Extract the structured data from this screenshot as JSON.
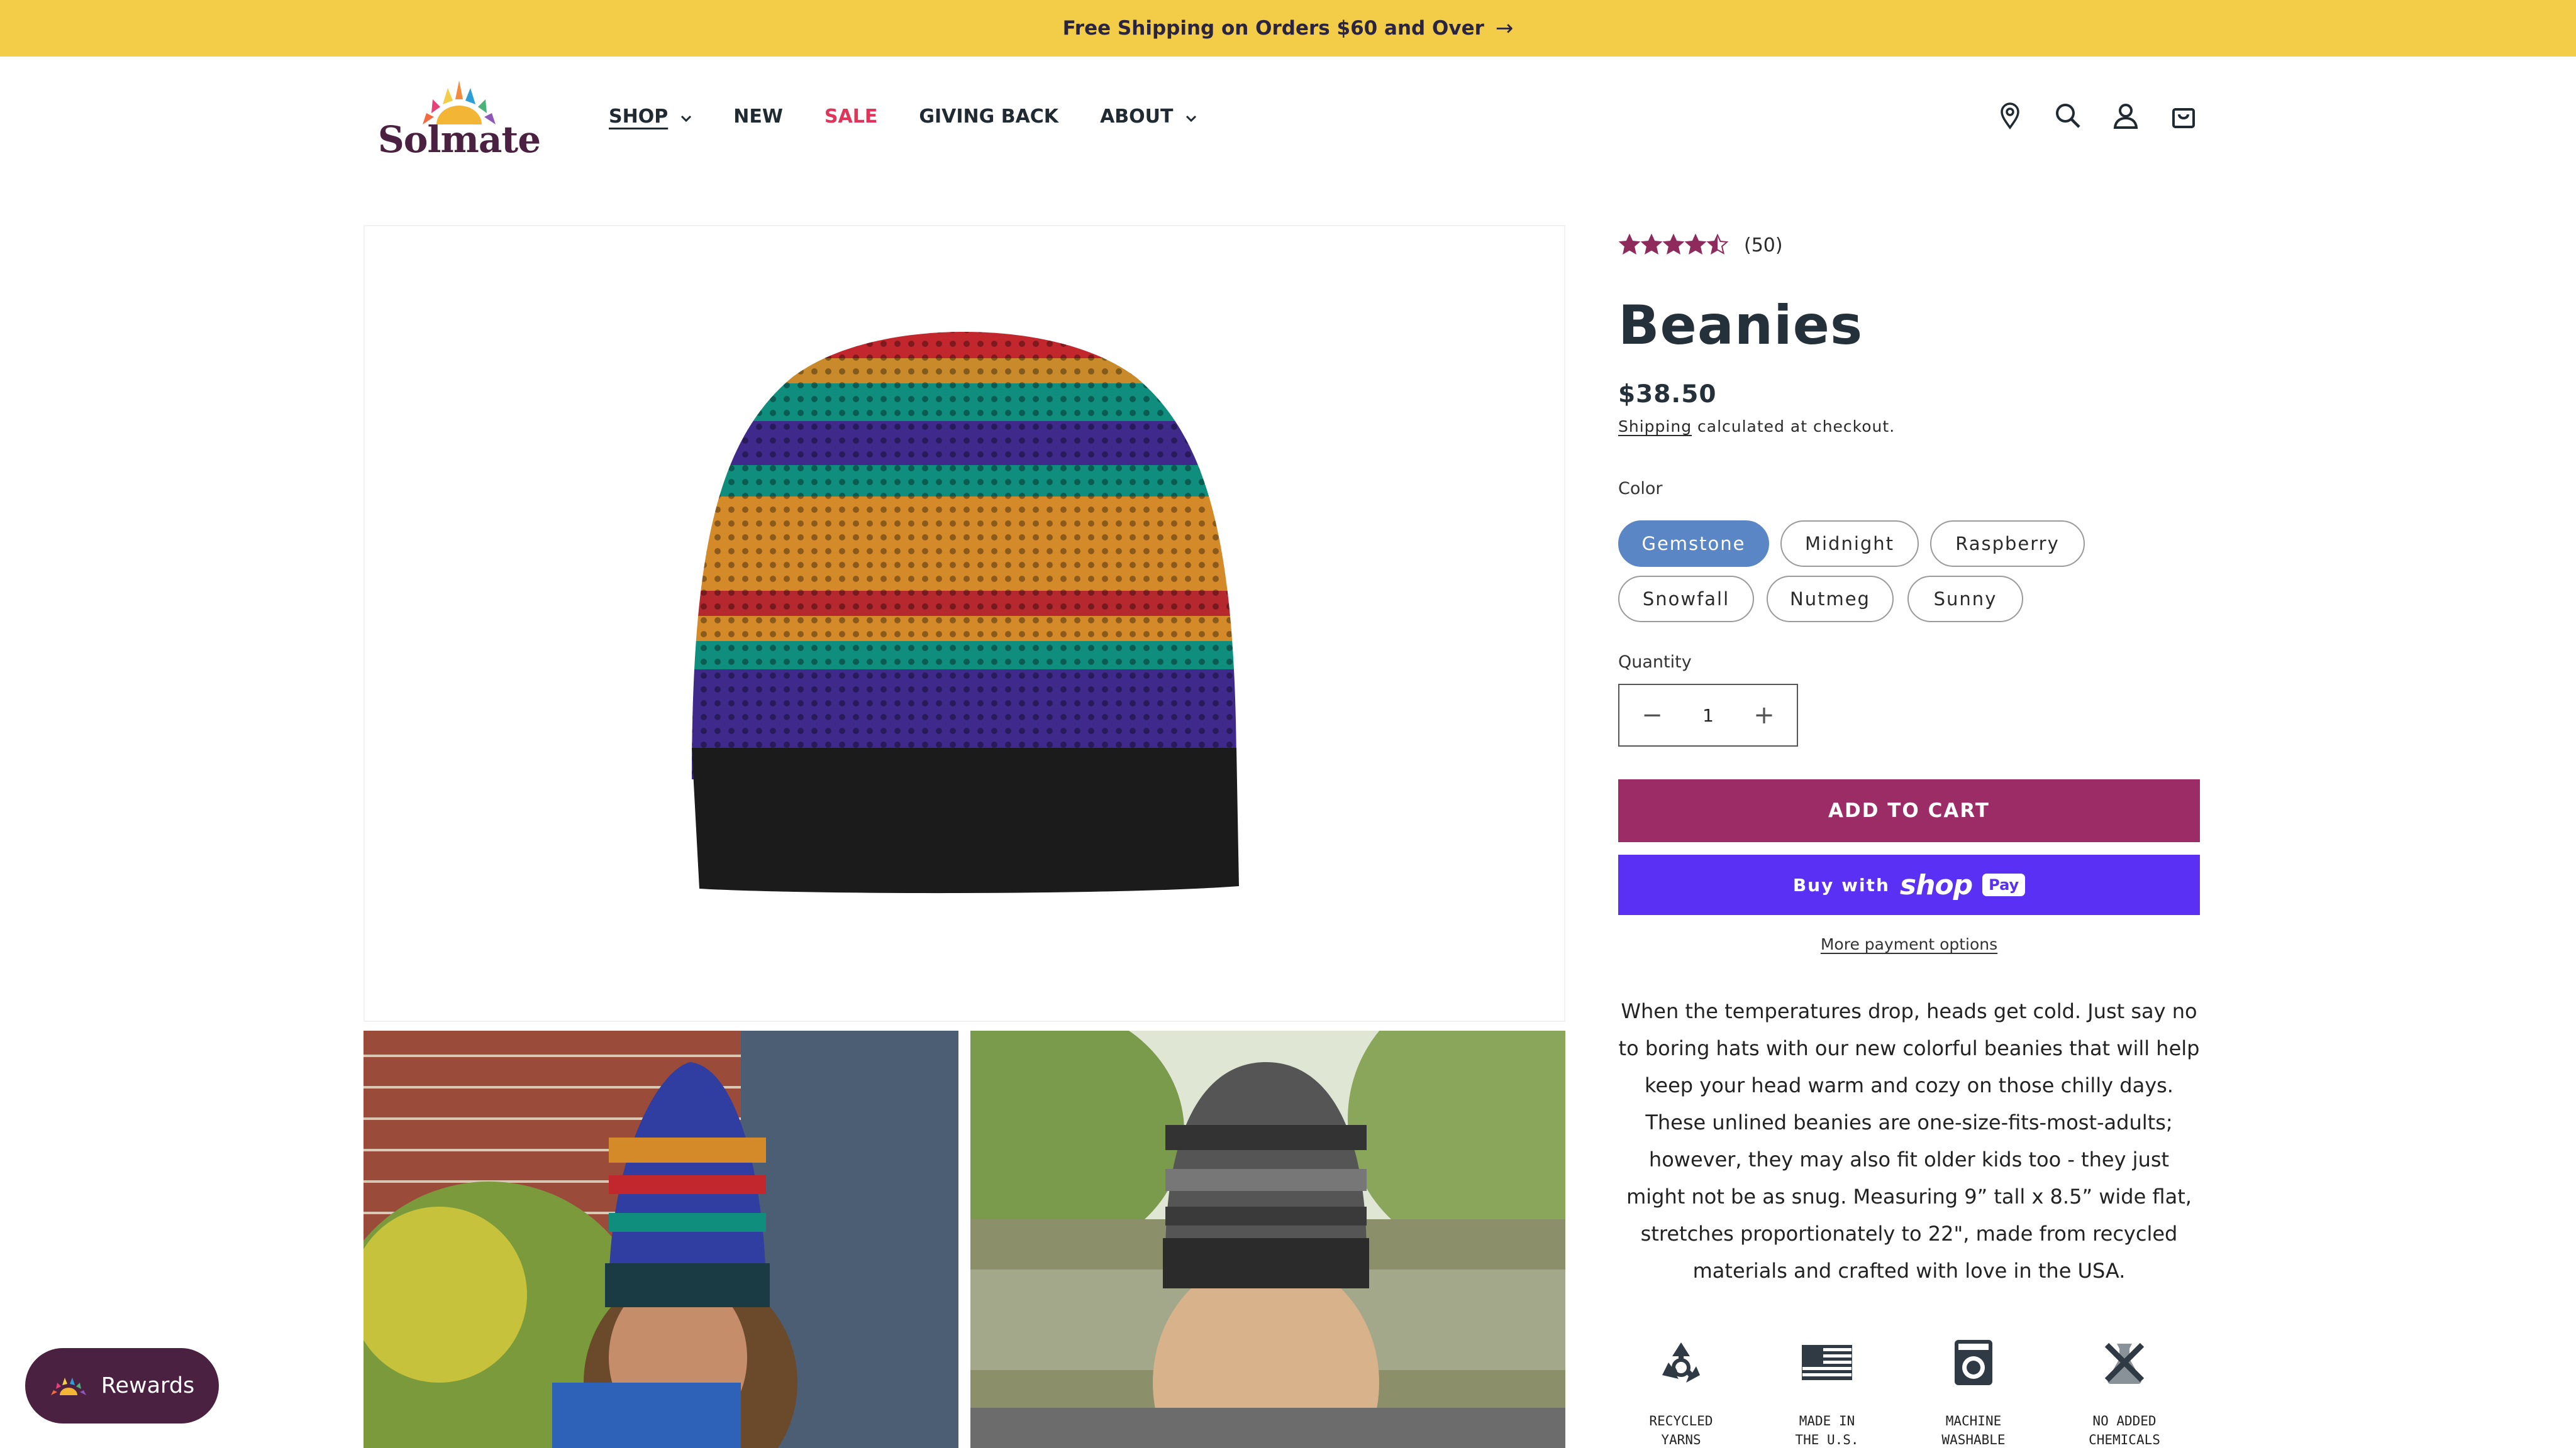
{
  "announcement": {
    "text": "Free Shipping on Orders $60 and Over",
    "arrow_icon": "arrow-right-icon"
  },
  "brand": {
    "name": "Solmate"
  },
  "nav": {
    "shop": "SHOP",
    "new": "NEW",
    "sale": "SALE",
    "giving_back": "GIVING BACK",
    "about": "ABOUT"
  },
  "header_icons": [
    "location-pin-icon",
    "search-icon",
    "account-icon",
    "cart-icon"
  ],
  "product": {
    "rating_value": 4.5,
    "review_count": "(50)",
    "title": "Beanies",
    "price": "$38.50",
    "shipping_link": "Shipping",
    "shipping_note": "calculated at checkout.",
    "color_label": "Color",
    "colors": [
      "Gemstone",
      "Midnight",
      "Raspberry",
      "Snowfall",
      "Nutmeg",
      "Sunny"
    ],
    "selected_color": "Gemstone",
    "quantity_label": "Quantity",
    "quantity": "1",
    "add_to_cart": "ADD TO CART",
    "buy_with": "Buy with",
    "shop_word": "shop",
    "pay_word": "Pay",
    "more_payment": "More payment options",
    "description": "When the temperatures drop, heads get cold. Just say no to boring hats with our new colorful beanies that will help keep your head warm and cozy on those chilly days. These unlined beanies are one-size-fits-most-adults; however, they may also fit older kids too - they just might not be as snug. Measuring 9” tall x 8.5” wide flat, stretches proportionately to 22\", made from recycled materials and crafted with love in the USA.",
    "features": [
      {
        "line1": "RECYCLED",
        "line2": "YARNS",
        "icon": "recycle-icon"
      },
      {
        "line1": "MADE IN",
        "line2": "THE U.S.",
        "icon": "us-flag-icon"
      },
      {
        "line1": "MACHINE",
        "line2": "WASHABLE",
        "icon": "washing-machine-icon"
      },
      {
        "line1": "NO ADDED",
        "line2": "CHEMICALS",
        "icon": "no-chemicals-icon"
      }
    ]
  },
  "rewards": {
    "label": "Rewards"
  },
  "colors": {
    "accent": "#9c2c66",
    "announcement_bg": "#f3cd48",
    "shoppay": "#5a31f4",
    "selected_swatch": "#5b86c6",
    "sale": "#e0345a",
    "brand_dark": "#4a2140"
  }
}
